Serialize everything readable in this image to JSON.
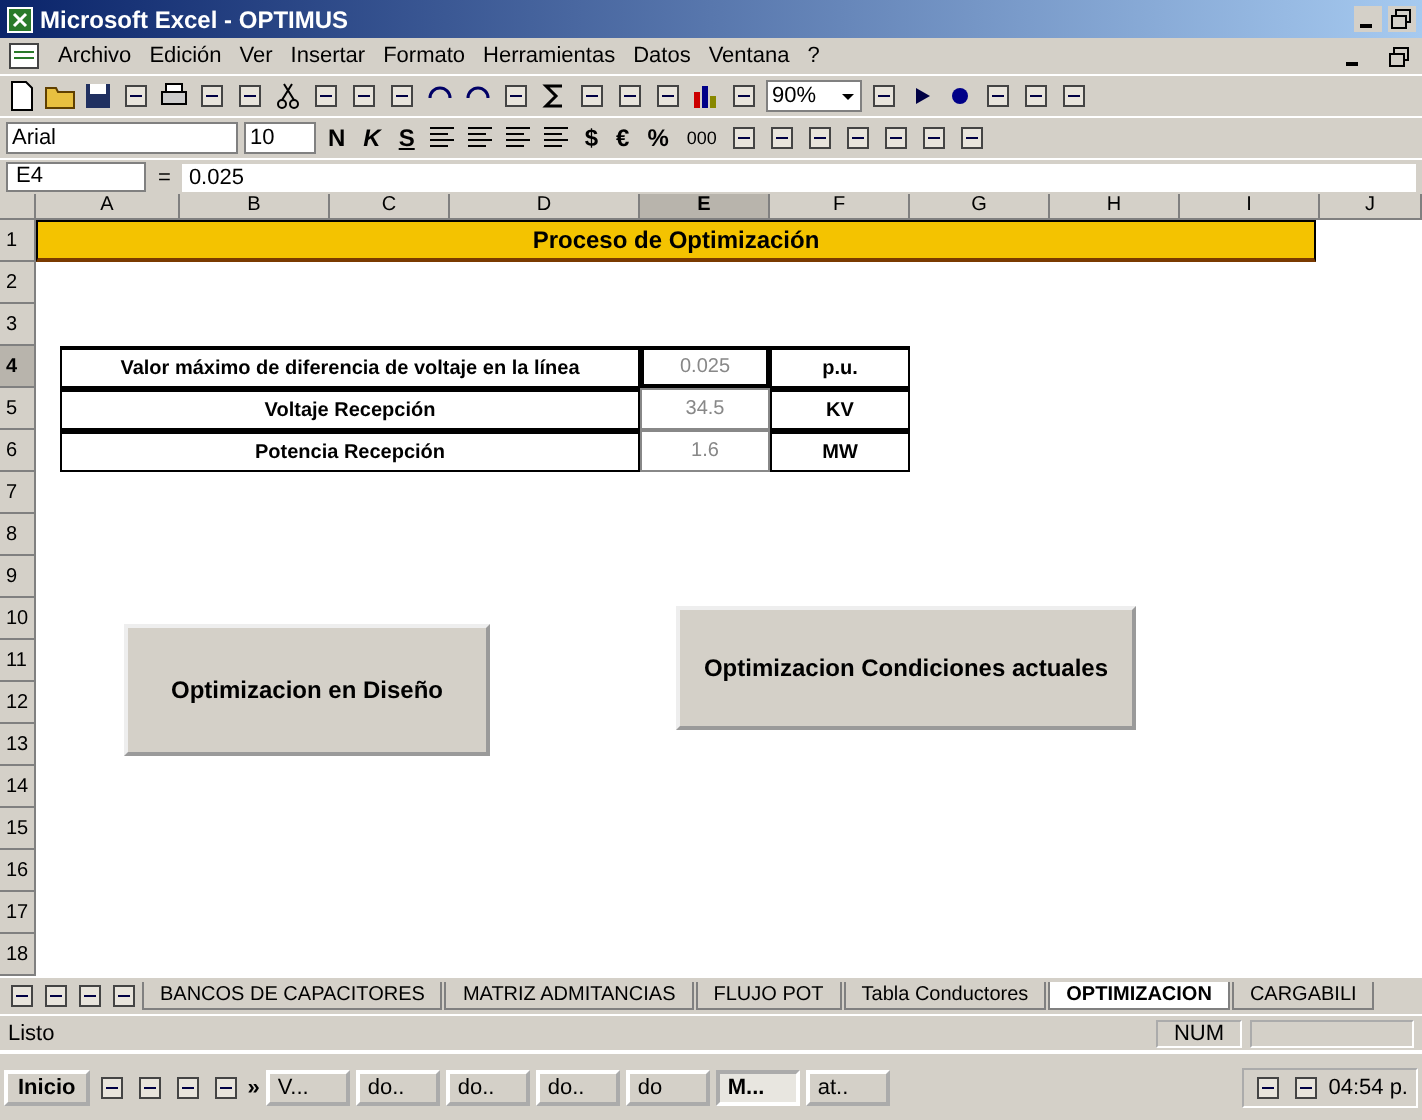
{
  "window": {
    "title": "Microsoft Excel - OPTIMUS"
  },
  "menu": [
    "Archivo",
    "Edición",
    "Ver",
    "Insertar",
    "Formato",
    "Herramientas",
    "Datos",
    "Ventana",
    "?"
  ],
  "toolbar": {
    "zoom": "90%"
  },
  "format_toolbar": {
    "font": "Arial",
    "size": "10",
    "bold": "N",
    "italic": "K",
    "underline": "S",
    "currency": "$",
    "euro": "€",
    "percent": "%",
    "thousands": "000"
  },
  "formula_bar": {
    "name_box": "E4",
    "equals": "=",
    "value": "0.025"
  },
  "columns": [
    {
      "label": "A",
      "selected": false
    },
    {
      "label": "B",
      "selected": false
    },
    {
      "label": "C",
      "selected": false
    },
    {
      "label": "D",
      "selected": false
    },
    {
      "label": "E",
      "selected": true
    },
    {
      "label": "F",
      "selected": false
    },
    {
      "label": "G",
      "selected": false
    },
    {
      "label": "H",
      "selected": false
    },
    {
      "label": "I",
      "selected": false
    },
    {
      "label": "J",
      "selected": false
    }
  ],
  "rows": [
    {
      "label": "1",
      "selected": false
    },
    {
      "label": "2",
      "selected": false
    },
    {
      "label": "3",
      "selected": false
    },
    {
      "label": "4",
      "selected": true
    },
    {
      "label": "5",
      "selected": false
    },
    {
      "label": "6",
      "selected": false
    },
    {
      "label": "7",
      "selected": false
    },
    {
      "label": "8",
      "selected": false
    },
    {
      "label": "9",
      "selected": false
    },
    {
      "label": "10",
      "selected": false
    },
    {
      "label": "11",
      "selected": false
    },
    {
      "label": "12",
      "selected": false
    },
    {
      "label": "13",
      "selected": false
    },
    {
      "label": "14",
      "selected": false
    },
    {
      "label": "15",
      "selected": false
    },
    {
      "label": "16",
      "selected": false
    },
    {
      "label": "17",
      "selected": false
    },
    {
      "label": "18",
      "selected": false
    }
  ],
  "sheet": {
    "banner": "Proceso de Optimización",
    "parameters": [
      {
        "label": "Valor máximo de diferencia de voltaje en la línea",
        "value": "0.025",
        "unit": "p.u."
      },
      {
        "label": "Voltaje Recepción",
        "value": "34.5",
        "unit": "KV"
      },
      {
        "label": "Potencia Recepción",
        "value": "1.6",
        "unit": "MW"
      }
    ],
    "buttons": [
      "Optimizacion en Diseño",
      "Optimizacion Condiciones actuales"
    ]
  },
  "sheet_tabs": [
    {
      "label": "BANCOS DE CAPACITORES",
      "selected": false
    },
    {
      "label": "MATRIZ ADMITANCIAS",
      "selected": false
    },
    {
      "label": "FLUJO POT",
      "selected": false
    },
    {
      "label": "Tabla Conductores",
      "selected": false
    },
    {
      "label": "OPTIMIZACION",
      "selected": true
    },
    {
      "label": "CARGABILI",
      "selected": false
    }
  ],
  "status_bar": {
    "text": "Listo",
    "num": "NUM"
  },
  "taskbar": {
    "start": "Inicio",
    "more": "»",
    "items": [
      {
        "label": "V...",
        "selected": false
      },
      {
        "label": "do..",
        "selected": false
      },
      {
        "label": "do..",
        "selected": false
      },
      {
        "label": "do..",
        "selected": false
      },
      {
        "label": "do",
        "selected": false
      },
      {
        "label": "M...",
        "selected": true
      },
      {
        "label": "at..",
        "selected": false
      }
    ],
    "clock": "04:54 p."
  }
}
